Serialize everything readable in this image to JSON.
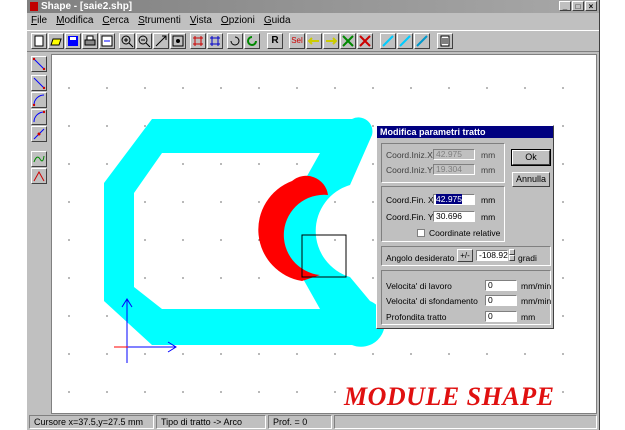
{
  "window": {
    "title": "Shape - [saie2.shp]"
  },
  "window_buttons": [
    "_",
    "□",
    "×"
  ],
  "menu": [
    "File",
    "Modifica",
    "Cerca",
    "Strumenti",
    "Vista",
    "Opzioni",
    "Guida"
  ],
  "toolbar": {
    "r_label": "R",
    "sel_label": "Sel"
  },
  "dialog": {
    "title": "Modifica parametri tratto",
    "ok_label": "Ok",
    "cancel_label": "Annulla",
    "start_x_label": "Coord.Iniz.X",
    "start_x_value": "42.975",
    "start_y_label": "Coord.Iniz.Y",
    "start_y_value": "19.304",
    "end_x_label": "Coord.Fin. X",
    "end_x_value": "42.975",
    "end_y_label": "Coord.Fin. Y",
    "end_y_value": "30.696",
    "relative_label": "Coordinate relative",
    "relative_checked": false,
    "unit_mm": "mm",
    "angle_label": "Angolo desiderato",
    "angle_toggle": "+/-",
    "angle_value": "-108.92",
    "angle_unit": "gradi",
    "work_speed_label": "Velocita' di lavoro",
    "work_speed_value": "0",
    "plunge_speed_label": "Velocita' di sfondamento",
    "plunge_speed_value": "0",
    "depth_label": "Profondita tratto",
    "depth_value": "0",
    "speed_unit": "mm/min"
  },
  "status": {
    "cursor": "Cursore x=37.5,y=27.5 mm",
    "segment_type": "Tipo di tratto -> Arco",
    "depth": "Prof. = 0"
  },
  "brand_text": "MODULE SHAPE",
  "colors": {
    "shape_fill": "#00ffff",
    "selected_arc": "#ff0000",
    "title_bar": "#000080",
    "brand": "#e01010"
  }
}
